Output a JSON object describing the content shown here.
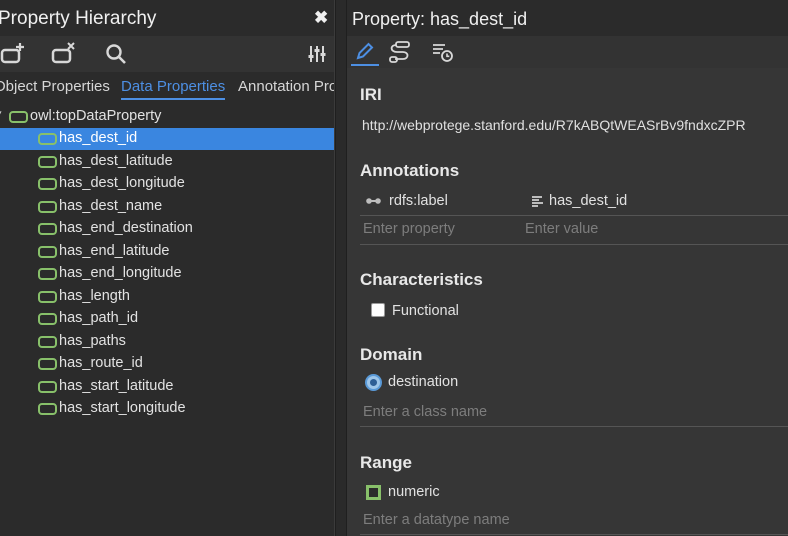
{
  "left_panel": {
    "title": "Property Hierarchy",
    "close_glyph": "✖",
    "toolbar": {
      "icons": [
        "add-property-icon",
        "delete-property-icon",
        "search-icon",
        "settings-sliders-icon"
      ]
    },
    "tabs": [
      {
        "label": "Object Properties",
        "active": false
      },
      {
        "label": "Data Properties",
        "active": true
      },
      {
        "label": "Annotation Pro",
        "active": false
      }
    ],
    "tree": {
      "root": "owl:topDataProperty",
      "items": [
        {
          "label": "has_dest_id",
          "selected": true
        },
        {
          "label": "has_dest_latitude",
          "selected": false
        },
        {
          "label": "has_dest_longitude",
          "selected": false
        },
        {
          "label": "has_dest_name",
          "selected": false
        },
        {
          "label": "has_end_destination",
          "selected": false
        },
        {
          "label": "has_end_latitude",
          "selected": false
        },
        {
          "label": "has_end_longitude",
          "selected": false
        },
        {
          "label": "has_length",
          "selected": false
        },
        {
          "label": "has_path_id",
          "selected": false
        },
        {
          "label": "has_paths",
          "selected": false
        },
        {
          "label": "has_route_id",
          "selected": false
        },
        {
          "label": "has_start_latitude",
          "selected": false
        },
        {
          "label": "has_start_longitude",
          "selected": false
        }
      ]
    }
  },
  "right_panel": {
    "title": "Property: has_dest_id",
    "tools": [
      "edit-pencil-icon",
      "hierarchy-path-icon",
      "history-list-icon"
    ],
    "iri": {
      "heading": "IRI",
      "value": "http://webprotege.stanford.edu/R7kABQtWEASrBv9fndxcZPR"
    },
    "annotations": {
      "heading": "Annotations",
      "property": "rdfs:label",
      "value": "has_dest_id",
      "property_placeholder": "Enter property",
      "value_placeholder": "Enter value"
    },
    "characteristics": {
      "heading": "Characteristics",
      "functional_label": "Functional",
      "functional_checked": false
    },
    "domain": {
      "heading": "Domain",
      "value": "destination",
      "placeholder": "Enter a class name"
    },
    "range": {
      "heading": "Range",
      "value": "numeric",
      "placeholder": "Enter a datatype name"
    }
  },
  "colors": {
    "accent": "#4d8fe3",
    "selection": "#3a86e0",
    "data_property_green": "#88c06a",
    "panel_bg": "#2b2b2b",
    "content_bg": "#363636"
  }
}
